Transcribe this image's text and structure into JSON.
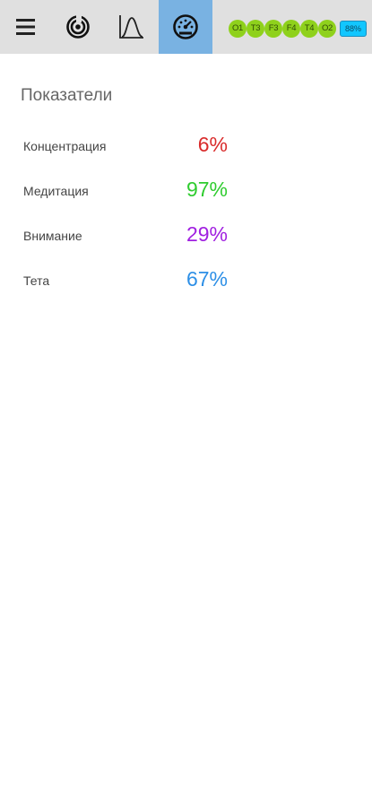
{
  "toolbar": {
    "icons": [
      "menu-icon",
      "target-icon",
      "peak-curve-icon",
      "gauge-icon"
    ],
    "active_tab": "gauge-icon",
    "active_color": "#79b2e2",
    "electrodes": [
      {
        "label": "O1",
        "color": "#8fd11c"
      },
      {
        "label": "T3",
        "color": "#8fd11c"
      },
      {
        "label": "F3",
        "color": "#8fd11c"
      },
      {
        "label": "F4",
        "color": "#8fd11c"
      },
      {
        "label": "T4",
        "color": "#8fd11c"
      },
      {
        "label": "O2",
        "color": "#8fd11c"
      }
    ],
    "battery": {
      "label": "88%",
      "level": 0.88,
      "color": "#12c6ff"
    }
  },
  "main": {
    "title": "Показатели",
    "metrics": [
      {
        "label": "Концентрация",
        "value": "6%",
        "color": "#d92b2b"
      },
      {
        "label": "Медитация",
        "value": "97%",
        "color": "#2fcc2f"
      },
      {
        "label": "Внимание",
        "value": "29%",
        "color": "#a020e0"
      },
      {
        "label": "Тета",
        "value": "67%",
        "color": "#2d8fe6"
      }
    ]
  }
}
